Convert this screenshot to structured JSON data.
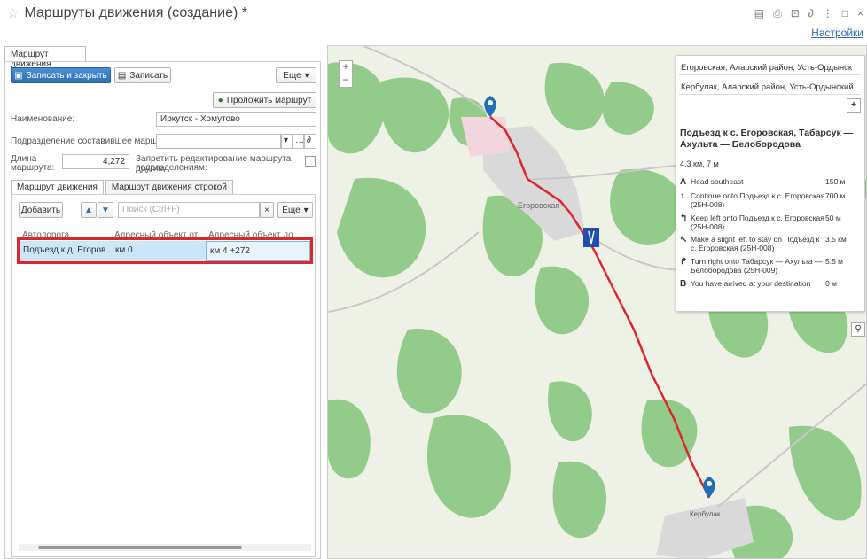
{
  "header": {
    "title": "Маршруты движения (создание) *",
    "settings_link": "Настройки"
  },
  "form": {
    "tab_label": "Маршрут движения",
    "save_close_label": "Записать и закрыть",
    "save_label": "Записать",
    "more_label": "Еще",
    "build_route_label": "Проложить маршрут",
    "name_label": "Наименование:",
    "name_value": "Иркутск - Хомутово",
    "division_label": "Подразделение составившее маршрут:",
    "division_value": "",
    "length_label_1": "Длина",
    "length_label_2": "маршрута:",
    "length_value": "4,272",
    "forbid_label_1": "Запретить редактирование маршрута другим",
    "forbid_label_2": "подразделениям:",
    "subtabs": [
      "Маршрут движения",
      "Маршрут движения строкой"
    ],
    "add_label": "Добавить",
    "search_placeholder": "Поиск (Ctrl+F)",
    "grid_more_label": "Еще",
    "columns": [
      "Автодорога",
      "Адресный объект от",
      "Адресный объект до"
    ],
    "rows": [
      {
        "road": "Подъезд к д. Егоров...",
        "from": "км 0",
        "to": "км 4 +272"
      }
    ]
  },
  "map": {
    "from_input": "Егоровская, Аларский район, Усть-Ордынск",
    "to_input": "Кербулак, Аларский район, Усть-Ордынский",
    "route_title": "Подъезд к с. Егоровская, Табарсук — Ахульта — Белобородова",
    "route_summary": "4.3 км, 7 м",
    "steps": [
      {
        "icon": "A",
        "text": "Head southeast",
        "dist": "150 м"
      },
      {
        "icon": "↑",
        "text": "Continue onto Подъезд к с. Егоровская (25Н-008)",
        "dist": "700 м"
      },
      {
        "icon": "↰",
        "text": "Keep left onto Подъезд к с. Егоровская (25Н-008)",
        "dist": "50 м"
      },
      {
        "icon": "↖",
        "text": "Make a slight left to stay on Подъезд к с. Егоровская (25Н-008)",
        "dist": "3.5 км"
      },
      {
        "icon": "↱",
        "text": "Turn right onto Табарсук — Ахульта — Белобородова (25Н-009)",
        "dist": "5.5 м"
      },
      {
        "icon": "B",
        "text": "You have arrived at your destination",
        "dist": "0 м"
      }
    ],
    "village_1": "Егоровская",
    "village_2": "Кербулак",
    "zoom_in": "+",
    "zoom_out": "−",
    "colors": {
      "route": "#e0262d",
      "forest": "#93cc8a",
      "land": "#eef2e6",
      "marker": "#1f6fb8"
    }
  }
}
